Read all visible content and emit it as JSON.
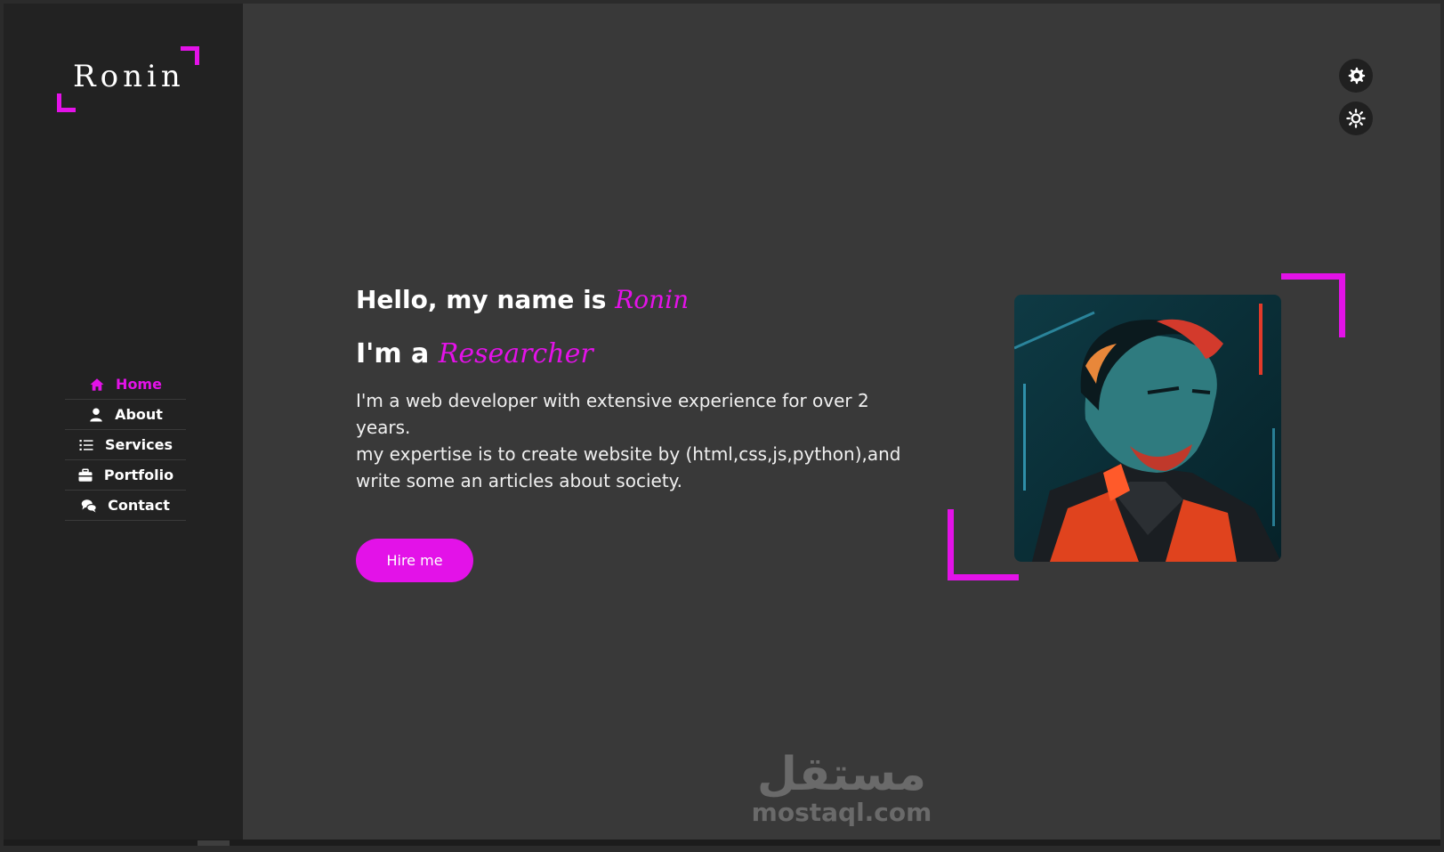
{
  "brand": {
    "logo_text": "Ronin"
  },
  "sidebar": {
    "items": [
      {
        "label": "Home",
        "icon": "home-icon",
        "active": true
      },
      {
        "label": "About",
        "icon": "user-icon",
        "active": false
      },
      {
        "label": "Services",
        "icon": "list-icon",
        "active": false
      },
      {
        "label": "Portfolio",
        "icon": "briefcase-icon",
        "active": false
      },
      {
        "label": "Contact",
        "icon": "chat-icon",
        "active": false
      }
    ]
  },
  "hero": {
    "greeting": "Hello, my name is",
    "name": "Ronin",
    "role_prefix": "I'm a",
    "role": "Researcher",
    "bio_lines": [
      "I'm a web developer with extensive experience for over 2 years.",
      "my expertise is to create website by (html,css,js,python),and",
      "write some an articles about society."
    ],
    "cta_label": "Hire me"
  },
  "controls": [
    {
      "icon": "gear-icon"
    },
    {
      "icon": "sun-icon"
    }
  ],
  "watermark": {
    "arabic": "مستقل",
    "latin": "mostaql.com"
  },
  "colors": {
    "accent": "#e312e8",
    "sidebar_bg": "#222222",
    "main_bg": "#393939",
    "text": "#ffffff"
  }
}
